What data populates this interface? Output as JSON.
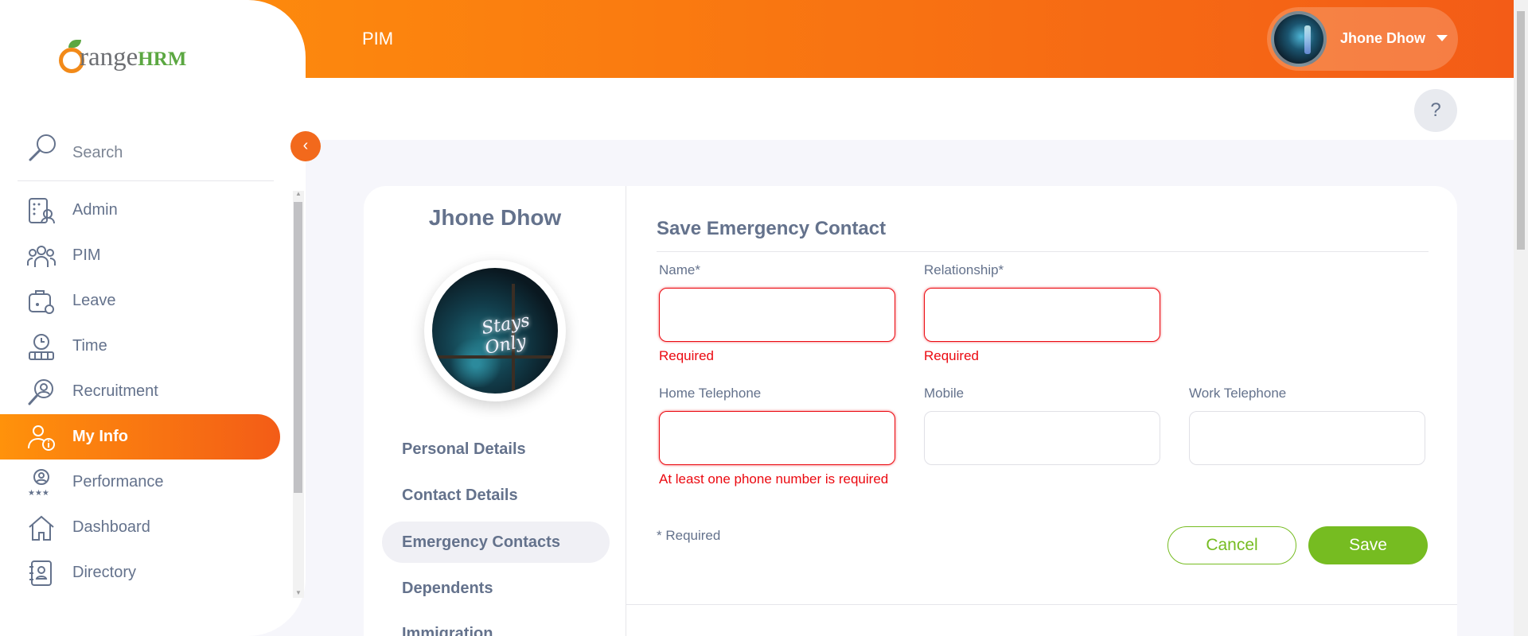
{
  "header": {
    "title": "PIM",
    "user_name": "Jhone Dhow",
    "help_label": "?"
  },
  "sidebar": {
    "logo_text": "range",
    "logo_hrm": "HRM",
    "search_label": "Search",
    "collapse_icon": "‹",
    "items": [
      {
        "label": "Admin",
        "icon": "admin-icon"
      },
      {
        "label": "PIM",
        "icon": "people-icon"
      },
      {
        "label": "Leave",
        "icon": "leave-icon"
      },
      {
        "label": "Time",
        "icon": "time-icon"
      },
      {
        "label": "Recruitment",
        "icon": "recruitment-icon"
      },
      {
        "label": "My Info",
        "icon": "my-info-icon",
        "active": true
      },
      {
        "label": "Performance",
        "icon": "performance-icon"
      },
      {
        "label": "Dashboard",
        "icon": "home-icon"
      },
      {
        "label": "Directory",
        "icon": "directory-icon"
      }
    ]
  },
  "profile": {
    "name": "Jhone Dhow",
    "photo_text": "Stays Only",
    "tabs": [
      {
        "label": "Personal Details"
      },
      {
        "label": "Contact Details"
      },
      {
        "label": "Emergency Contacts",
        "active": true
      },
      {
        "label": "Dependents"
      },
      {
        "label": "Immigration"
      }
    ]
  },
  "form": {
    "title": "Save Emergency Contact",
    "name_label": "Name*",
    "name_value": "",
    "name_error": "Required",
    "relationship_label": "Relationship*",
    "relationship_value": "",
    "relationship_error": "Required",
    "home_tel_label": "Home Telephone",
    "home_tel_value": "",
    "home_tel_error": "At least one phone number is required",
    "mobile_label": "Mobile",
    "mobile_value": "",
    "work_tel_label": "Work Telephone",
    "work_tel_value": "",
    "required_note": "* Required",
    "cancel_label": "Cancel",
    "save_label": "Save"
  },
  "colors": {
    "brand_orange": "#ff7b1d",
    "accent_green": "#76bc21",
    "error_red": "#eb0910",
    "text": "#64728c"
  }
}
